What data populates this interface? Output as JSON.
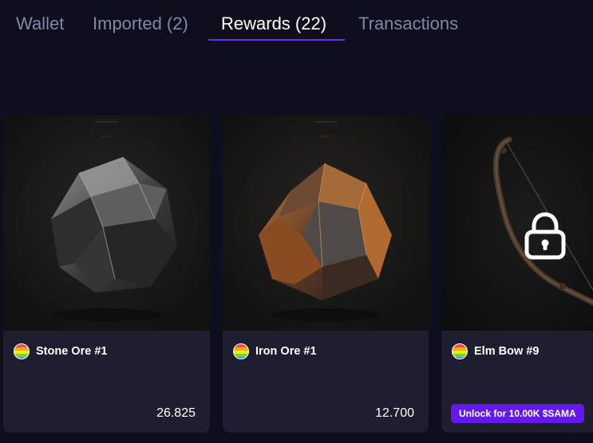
{
  "tabs": [
    {
      "label": "Wallet",
      "active": false
    },
    {
      "label": "Imported (2)",
      "active": false
    },
    {
      "label": "Rewards (22)",
      "active": true
    },
    {
      "label": "Transactions",
      "active": false
    }
  ],
  "colors": {
    "accent": "#6b2bf0",
    "background": "#0f0e1c",
    "card": "#1f1e30",
    "button": "#6419ec"
  },
  "cards": [
    {
      "name": "Stone Ore #1",
      "value": "26.825",
      "badge_icon": "rainbow-token-icon",
      "image": "stone-ore-image",
      "locked": false
    },
    {
      "name": "Iron Ore #1",
      "value": "12.700",
      "badge_icon": "rainbow-token-icon",
      "image": "iron-ore-image",
      "locked": false
    },
    {
      "name": "Elm Bow #9",
      "unlock_label": "Unlock for 10.00K $SAMA",
      "badge_icon": "rainbow-token-icon",
      "image": "elm-bow-image",
      "locked": true,
      "lock_icon": "lock-icon"
    }
  ]
}
